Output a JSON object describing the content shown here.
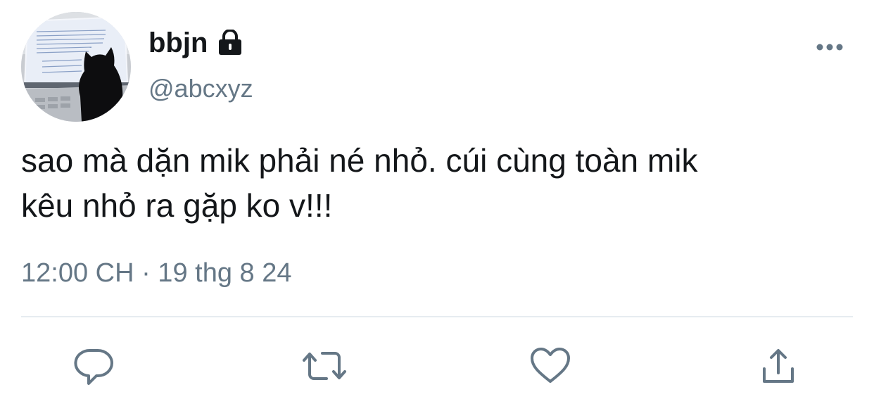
{
  "user": {
    "display_name": "bbjn",
    "handle": "@abcxyz",
    "protected_icon": "lock-icon",
    "avatar_icon": "avatar-cat-laptop"
  },
  "tweet": {
    "text": "sao mà dặn mik phải né nhỏ. cúi cùng toàn mik\nkêu nhỏ ra gặp ko v!!!",
    "timestamp": "12:00 CH · 19 thg 8 24"
  },
  "actions": [
    {
      "name": "reply",
      "icon": "reply-icon"
    },
    {
      "name": "retweet",
      "icon": "retweet-icon"
    },
    {
      "name": "like",
      "icon": "heart-icon"
    },
    {
      "name": "share",
      "icon": "share-icon"
    }
  ],
  "menu": {
    "icon": "more-icon"
  },
  "colors": {
    "text": "#14171a",
    "secondary": "#657786",
    "divider": "#e6ecf0",
    "icon": "#657786"
  }
}
